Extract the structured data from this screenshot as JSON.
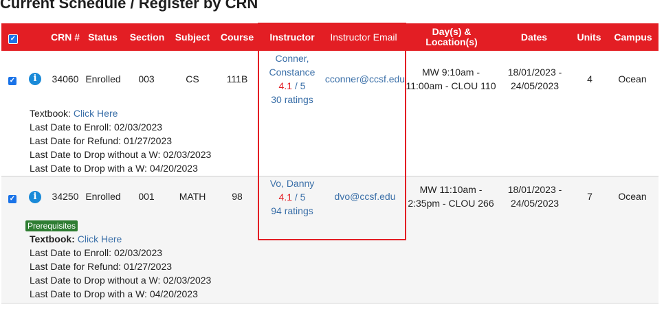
{
  "page": {
    "title": "Current Schedule / Register by CRN"
  },
  "table": {
    "headers": {
      "crn": "CRN #",
      "status": "Status",
      "section": "Section",
      "subject": "Subject",
      "course": "Course",
      "instructor": "Instructor",
      "instructor_email": "Instructor Email",
      "days_location": "Day(s) & Location(s)",
      "dates": "Dates",
      "units": "Units",
      "campus": "Campus"
    },
    "rows": [
      {
        "checked": true,
        "crn": "34060",
        "status": "Enrolled",
        "section": "003",
        "subject": "CS",
        "course": "111B",
        "instructor_line1": "Conner,",
        "instructor_line2": "Constance",
        "rating": "4.1",
        "rating_out_of": " / 5",
        "rating_count": "30 ratings",
        "email": "cconner@ccsf.edu",
        "days_line1": "MW 9:10am -",
        "days_line2": "11:00am - CLOU 110",
        "dates_line1": "18/01/2023 -",
        "dates_line2": "24/05/2023",
        "units": "4",
        "campus": "Ocean",
        "prerequisites": "",
        "textbook_label": "Textbook:",
        "textbook_link": "Click Here",
        "last_enroll": "Last Date to Enroll: 02/03/2023",
        "last_refund": "Last Date for Refund: 01/27/2023",
        "drop_without_w": "Last Date to Drop without a W: 02/03/2023",
        "drop_with_w": "Last Date to Drop with a W: 04/20/2023"
      },
      {
        "checked": true,
        "crn": "34250",
        "status": "Enrolled",
        "section": "001",
        "subject": "MATH",
        "course": "98",
        "instructor_line1": "Vo, Danny",
        "instructor_line2": "",
        "rating": "4.1",
        "rating_out_of": " / 5",
        "rating_count": "94 ratings",
        "email": "dvo@ccsf.edu",
        "days_line1": "MW 11:10am -",
        "days_line2": "2:35pm - CLOU 266",
        "dates_line1": "18/01/2023 -",
        "dates_line2": "24/05/2023",
        "units": "7",
        "campus": "Ocean",
        "prerequisites": "Prerequisites",
        "textbook_label": "Textbook:",
        "textbook_link": "Click Here",
        "last_enroll": "Last Date to Enroll: 02/03/2023",
        "last_refund": "Last Date for Refund: 01/27/2023",
        "drop_without_w": "Last Date to Drop without a W: 02/03/2023",
        "drop_with_w": "Last Date to Drop with a W: 04/20/2023"
      }
    ]
  },
  "colors": {
    "header": "#e31e24",
    "link": "#3a6fa8",
    "rating": "#e31e24",
    "badge": "#2e7d32",
    "checkbox": "#1a73e8"
  }
}
